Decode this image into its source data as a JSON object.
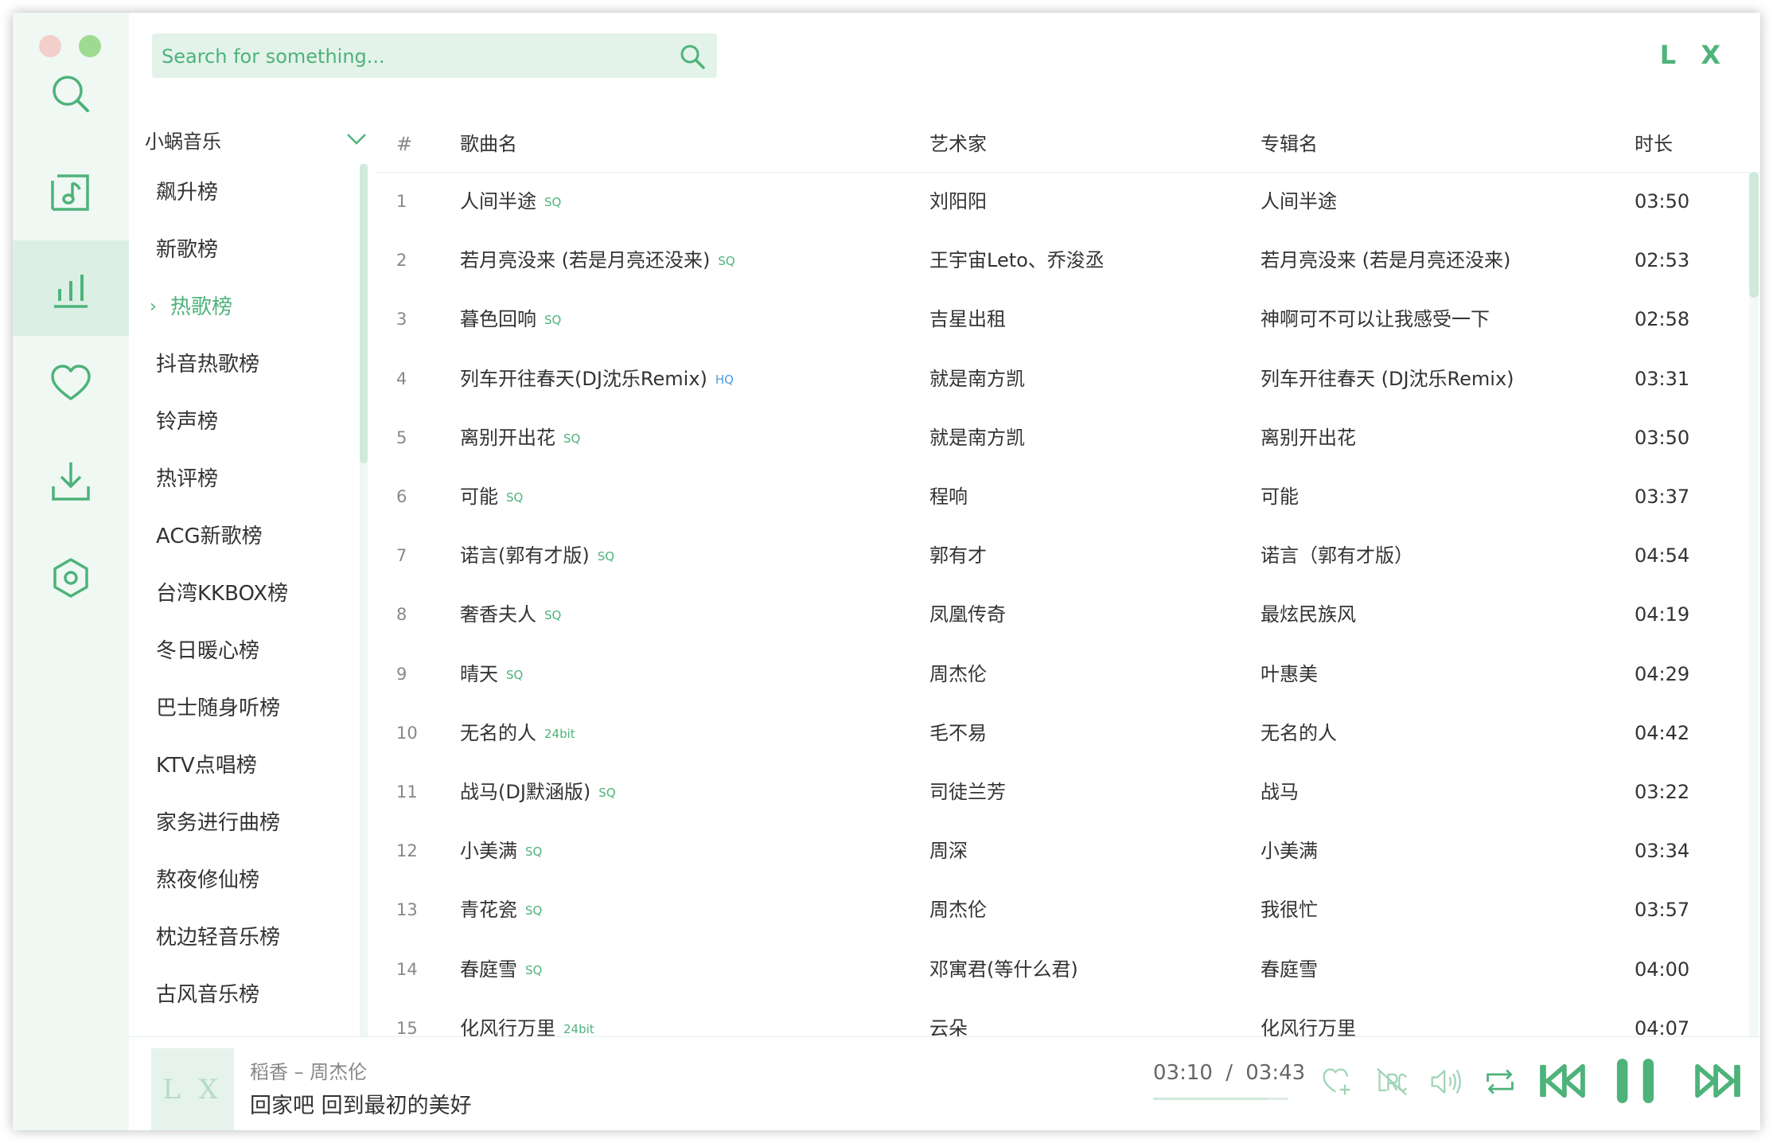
{
  "window": {
    "logo": "L X",
    "accent": "#4db37a"
  },
  "rail": {
    "items": [
      {
        "name": "search",
        "icon": "search-icon"
      },
      {
        "name": "song-list",
        "icon": "music-list-icon"
      },
      {
        "name": "leaderboard",
        "icon": "bar-chart-icon",
        "active": true
      },
      {
        "name": "favorites",
        "icon": "heart-icon"
      },
      {
        "name": "download",
        "icon": "download-icon"
      },
      {
        "name": "settings",
        "icon": "gear-icon"
      }
    ]
  },
  "search": {
    "placeholder": "Search for something..."
  },
  "source": {
    "label": "小蜗音乐"
  },
  "boards": [
    "飙升榜",
    "新歌榜",
    "热歌榜",
    "抖音热歌榜",
    "铃声榜",
    "热评榜",
    "ACG新歌榜",
    "台湾KKBOX榜",
    "冬日暖心榜",
    "巴士随身听榜",
    "KTV点唱榜",
    "家务进行曲榜",
    "熬夜修仙榜",
    "枕边轻音乐榜",
    "古风音乐榜"
  ],
  "active_board_index": 2,
  "table": {
    "headers": {
      "index": "#",
      "name": "歌曲名",
      "artist": "艺术家",
      "album": "专辑名",
      "duration": "时长"
    },
    "rows": [
      {
        "idx": "1",
        "name": "人间半途",
        "badge": "SQ",
        "artist": "刘阳阳",
        "album": "人间半途",
        "duration": "03:50"
      },
      {
        "idx": "2",
        "name": "若月亮没来 (若是月亮还没来)",
        "badge": "SQ",
        "artist": "王宇宙Leto、乔浚丞",
        "album": "若月亮没来 (若是月亮还没来)",
        "duration": "02:53"
      },
      {
        "idx": "3",
        "name": "暮色回响",
        "badge": "SQ",
        "artist": "吉星出租",
        "album": "神啊可不可以让我感受一下",
        "duration": "02:58"
      },
      {
        "idx": "4",
        "name": "列车开往春天(DJ沈乐Remix)",
        "badge": "HQ",
        "artist": "就是南方凯",
        "album": "列车开往春天 (DJ沈乐Remix)",
        "duration": "03:31"
      },
      {
        "idx": "5",
        "name": "离别开出花",
        "badge": "SQ",
        "artist": "就是南方凯",
        "album": "离别开出花",
        "duration": "03:50"
      },
      {
        "idx": "6",
        "name": "可能",
        "badge": "SQ",
        "artist": "程响",
        "album": "可能",
        "duration": "03:37"
      },
      {
        "idx": "7",
        "name": "诺言(郭有才版)",
        "badge": "SQ",
        "artist": "郭有才",
        "album": "诺言（郭有才版）",
        "duration": "04:54"
      },
      {
        "idx": "8",
        "name": "奢香夫人",
        "badge": "SQ",
        "artist": "凤凰传奇",
        "album": "最炫民族风",
        "duration": "04:19"
      },
      {
        "idx": "9",
        "name": "晴天",
        "badge": "SQ",
        "artist": "周杰伦",
        "album": "叶惠美",
        "duration": "04:29"
      },
      {
        "idx": "10",
        "name": "无名的人",
        "badge": "24bit",
        "artist": "毛不易",
        "album": "无名的人",
        "duration": "04:42"
      },
      {
        "idx": "11",
        "name": "战马(DJ默涵版)",
        "badge": "SQ",
        "artist": "司徒兰芳",
        "album": "战马",
        "duration": "03:22"
      },
      {
        "idx": "12",
        "name": "小美满",
        "badge": "SQ",
        "artist": "周深",
        "album": "小美满",
        "duration": "03:34"
      },
      {
        "idx": "13",
        "name": "青花瓷",
        "badge": "SQ",
        "artist": "周杰伦",
        "album": "我很忙",
        "duration": "03:57"
      },
      {
        "idx": "14",
        "name": "春庭雪",
        "badge": "SQ",
        "artist": "邓寓君(等什么君)",
        "album": "春庭雪",
        "duration": "04:00"
      },
      {
        "idx": "15",
        "name": "化风行万里",
        "badge": "24bit",
        "artist": "云朵",
        "album": "化风行万里",
        "duration": "04:07"
      }
    ]
  },
  "player": {
    "cover_text": "L X",
    "title": "稻香 – 周杰伦",
    "lyric": "回家吧 回到最初的美好",
    "current_time": "03:10",
    "separator": "/",
    "total_time": "03:43",
    "progress": 0.85,
    "buttons": [
      "heart-add-icon",
      "lyric-icon",
      "volume-icon",
      "repeat-icon",
      "previous-icon",
      "pause-icon",
      "next-icon"
    ]
  }
}
